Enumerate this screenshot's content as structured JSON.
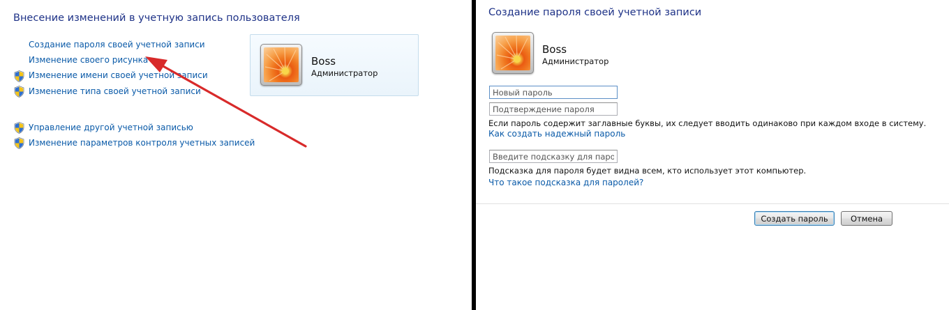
{
  "left": {
    "title": "Внесение изменений в учетную запись пользователя",
    "links": [
      {
        "label": "Создание пароля своей учетной записи",
        "shield": false
      },
      {
        "label": "Изменение своего рисунка",
        "shield": false
      },
      {
        "label": "Изменение имени своей учетной записи",
        "shield": true
      },
      {
        "label": "Изменение типа своей учетной записи",
        "shield": true
      },
      {
        "label": "Управление другой учетной записью",
        "shield": true
      },
      {
        "label": "Изменение параметров контроля учетных записей",
        "shield": true
      }
    ],
    "user": {
      "name": "Boss",
      "role": "Администратор"
    },
    "arrow_color": "#d82a2a"
  },
  "right": {
    "title": "Создание пароля своей учетной записи",
    "user": {
      "name": "Boss",
      "role": "Администратор"
    },
    "new_password_placeholder": "Новый пароль",
    "confirm_password_placeholder": "Подтверждение пароля",
    "case_note": "Если пароль содержит заглавные буквы, их следует вводить одинаково при каждом входе в систему.",
    "strong_password_link": "Как создать надежный пароль",
    "hint_placeholder": "Введите подсказку для пароля",
    "hint_note": "Подсказка для пароля будет видна всем, кто использует этот компьютер.",
    "hint_link": "Что такое подсказка для паролей?",
    "create_button": "Создать пароль",
    "cancel_button": "Отмена"
  },
  "colors": {
    "title": "#1e3287",
    "link": "#0a5aa8",
    "divider": "#000000"
  }
}
